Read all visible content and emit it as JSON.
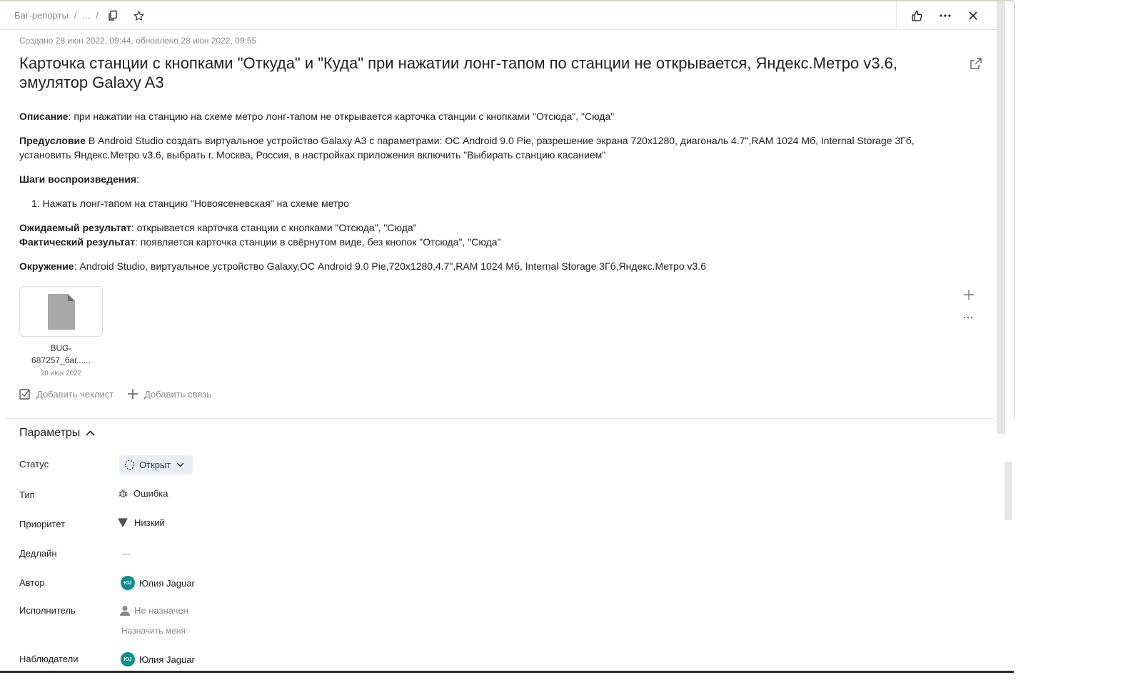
{
  "breadcrumb": {
    "root": "Баг-репорты",
    "ellipsis": "...",
    "separator": "/"
  },
  "header_icons": [
    "copy-icon",
    "star-icon",
    "thumbs-up-icon",
    "more-icon",
    "close-icon"
  ],
  "meta": "Создано 28 июн 2022, 09:44, обновлено 28 июн 2022, 09:55",
  "title": "Карточка станции с кнопками \"Откуда\" и \"Куда\" при нажатии лонг-тапом по станции не открывается, Яндекс.Метро v3.6, эмулятор Galaxy A3",
  "description": {
    "desc_label": "Описание",
    "desc_text": ": при нажатии на станцию на схеме метро лонг-тапом не открывается карточка станции с кнопками \"Отсюда\", \"Сюда\"",
    "pre_label": "Предусловие",
    "pre_text": " В Android Studio создать виртуальное устройство Galaxy A3 с параметрами: ОС Android 9.0 Pie, разрешение экрана 720х1280, диагональ 4.7\",RAM 1024 Мб, Internal Storage 3Гб, установить Яндекс.Метро v3.6, выбрать г. Москва, Россия, в настройках приложения включить \"Выбирать станцию касанием\"",
    "steps_label": "Шаги воспроизведения",
    "steps_colon": ":",
    "step1": "1. Нажать лонг-тапом на станцию \"Новоясеневская\" на схеме метро",
    "expected_label": "Ожидаемый результат",
    "expected_text": ": открывается карточка станции с кнопками \"Отсюда\", \"Сюда\"",
    "actual_label": "Фактический результат",
    "actual_text": ": появляется карточка станции в свёрнутом виде, без кнопок \"Отсюда\", \"Сюда\"",
    "env_label": "Окружение",
    "env_text": ": Android Studio, виртуальное устройство Galaxy,ОС Android 9.0 Pie,720х1280,4.7\",RAM 1024 Мб, Internal Storage 3Гб,Яндекс.Метро v3.6"
  },
  "attachment": {
    "name_line1": "BUG-",
    "name_line2": "687257_баг......",
    "date": "28 июн 2022"
  },
  "actions": {
    "add_checklist": "Добавить чеклист",
    "add_link": "Добавить связь"
  },
  "params": {
    "heading": "Параметры",
    "status_label": "Статус",
    "status_value": "Открыт",
    "type_label": "Тип",
    "type_value": "Ошибка",
    "priority_label": "Приоритет",
    "priority_value": "Низкий",
    "deadline_label": "Дедлайн",
    "deadline_value": "—",
    "author_label": "Автор",
    "author_initials": "ЮJ",
    "author_value": "Юлия Jaguar",
    "assignee_label": "Исполнитель",
    "assignee_value": "Не назначен",
    "assign_me": "Назначить меня",
    "watchers_label": "Наблюдатели",
    "watcher_initials": "ЮJ",
    "watcher_value": "Юлия Jaguar"
  },
  "colors": {
    "accent_teal": "#0e8e8a",
    "status_bg": "#e9eef5"
  }
}
